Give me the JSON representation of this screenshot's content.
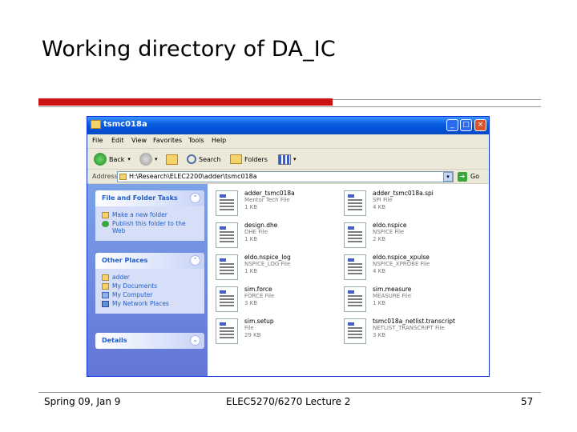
{
  "slide": {
    "title": "Working directory of DA_IC",
    "footer_left": "Spring 09, Jan 9",
    "footer_center": "ELEC5270/6270 Lecture 2",
    "footer_right": "57"
  },
  "window": {
    "title": "tsmc018a",
    "min_label": "_",
    "max_label": "□",
    "close_label": "×"
  },
  "menu": {
    "items": [
      "File",
      "Edit",
      "View",
      "Favorites",
      "Tools",
      "Help"
    ]
  },
  "toolbar": {
    "back_label": "Back",
    "forward_label": "",
    "up_label": "",
    "search_label": "Search",
    "folders_label": "Folders",
    "views_label": "",
    "dropdown": "▾"
  },
  "address": {
    "label": "Address",
    "value": "H:\\Research\\ELEC2200\\adder\\tsmc018a",
    "go_label": "Go"
  },
  "taskpane": {
    "file_folder_tasks": {
      "title": "File and Folder Tasks",
      "items": [
        "Make a new folder",
        "Publish this folder to the Web"
      ]
    },
    "other_places": {
      "title": "Other Places",
      "items": [
        "adder",
        "My Documents",
        "My Computer",
        "My Network Places"
      ]
    },
    "details": {
      "title": "Details"
    },
    "chevron_up": "⌃",
    "chevron_down": "⌄"
  },
  "files": [
    {
      "name": "adder_tsmc018a",
      "type": "Mentor Tech File",
      "size": "1 KB"
    },
    {
      "name": "adder_tsmc018a.spi",
      "type": "SPI File",
      "size": "4 KB"
    },
    {
      "name": "design.dhe",
      "type": "DHE File",
      "size": "1 KB"
    },
    {
      "name": "eldo.nspice",
      "type": "NSPICE File",
      "size": "2 KB"
    },
    {
      "name": "eldo.nspice_log",
      "type": "NSPICE_LOG File",
      "size": "1 KB"
    },
    {
      "name": "eldo.nspice_xpulse",
      "type": "NSPICE_XPROBE File",
      "size": "4 KB"
    },
    {
      "name": "sim.force",
      "type": "FORCE File",
      "size": "3 KB"
    },
    {
      "name": "sim.measure",
      "type": "MEASURE File",
      "size": "1 KB"
    },
    {
      "name": "sim.setup",
      "type": "File",
      "size": "29 KB"
    },
    {
      "name": "tsmc018a_netlist.transcript",
      "type": "NETLIST_TRANSCRIPT File",
      "size": "3 KB"
    }
  ],
  "colors": {
    "accent_red": "#cc1111",
    "xp_blue": "#0a5de0",
    "task_blue": "#215dc6"
  }
}
